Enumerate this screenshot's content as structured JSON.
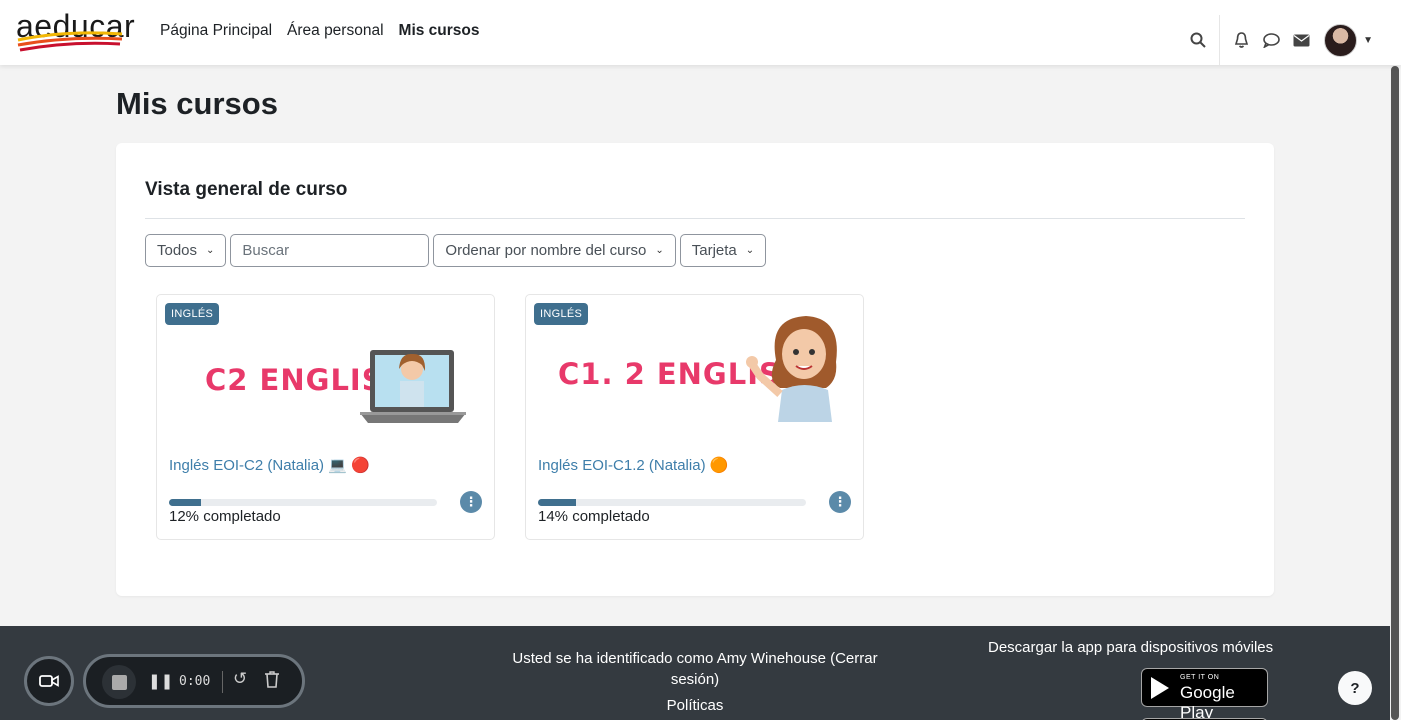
{
  "nav": {
    "logo_text": "aeducar",
    "links": [
      "Página Principal",
      "Área personal",
      "Mis cursos"
    ],
    "icons": [
      "search-icon",
      "bell-icon",
      "chat-icon",
      "envelope-icon"
    ]
  },
  "page": {
    "title": "Mis cursos",
    "block_title": "Vista general de curso"
  },
  "filters": {
    "grouping": "Todos",
    "search_placeholder": "Buscar",
    "sort": "Ordenar por nombre del curso",
    "view": "Tarjeta"
  },
  "courses": [
    {
      "category": "INGLÉS",
      "image_text": "C2 ENGLISH",
      "name": "Inglés EOI-C2 (Natalia) 💻 🔴",
      "progress": 0.12,
      "progress_text": "12% completado"
    },
    {
      "category": "INGLÉS",
      "image_text": "C1. 2 ENGLISH",
      "name": "Inglés EOI-C1.2 (Natalia) 🟠",
      "progress": 0.14,
      "progress_text": "14% completado"
    }
  ],
  "footer": {
    "login_info": "Usted se ha identificado como Amy Winehouse (Cerrar sesión)",
    "policies": "Políticas",
    "app_download": "Descargar la app para dispositivos móviles",
    "gplay_small": "GET IT ON",
    "gplay_big": "Google Play",
    "help": "?"
  },
  "recorder": {
    "time": "0:00"
  },
  "colors": {
    "accent": "#3f6f8e",
    "link": "#3e7eaa",
    "title_pink": "#e8396a",
    "footer_bg": "#343a40"
  }
}
